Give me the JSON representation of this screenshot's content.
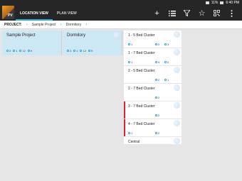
{
  "status": {
    "battery": "11%",
    "time": "6:40 PM"
  },
  "app": {
    "logo_text": "PV"
  },
  "tabs": [
    {
      "label": "LOCATION VIEW"
    },
    {
      "label": "PLAN VIEW"
    }
  ],
  "breadcrumb": {
    "label": "PROJECT:",
    "items": [
      "Sample Project",
      "Dormitory"
    ]
  },
  "columns": [
    {
      "title": "Sample Project",
      "stats": [
        "3",
        "1",
        "12",
        "9"
      ]
    },
    {
      "title": "Dormitory",
      "stats": [
        "3",
        "1",
        "12",
        "9"
      ]
    }
  ],
  "rows": [
    {
      "title": "1 - 5 Bed Cluster",
      "stats": [
        "1",
        "2",
        "3"
      ],
      "flag": false
    },
    {
      "title": "1 - 7 Bed Cluster",
      "stats": [
        "1",
        "4",
        "5"
      ],
      "flag": false
    },
    {
      "title": "2 - 5 Bed Cluster",
      "stats": [
        "",
        "2",
        "1"
      ],
      "flag": false
    },
    {
      "title": "2 - 7 Bed Cluster",
      "stats": [
        "",
        "2",
        ""
      ],
      "flag": false
    },
    {
      "title": "3 - 7 Bed Cluster",
      "stats": [
        "",
        "2",
        ""
      ],
      "flag": true
    },
    {
      "title": "4 - 7 Bed Cluster",
      "stats": [
        "1",
        "2",
        ""
      ],
      "flag": true
    },
    {
      "title": "Central",
      "stats": [],
      "flag": false
    }
  ],
  "colors": {
    "accent": "#2fa8e0",
    "selected": "#cde8f5",
    "flag": "#d9232d",
    "appbar": "#262626"
  }
}
